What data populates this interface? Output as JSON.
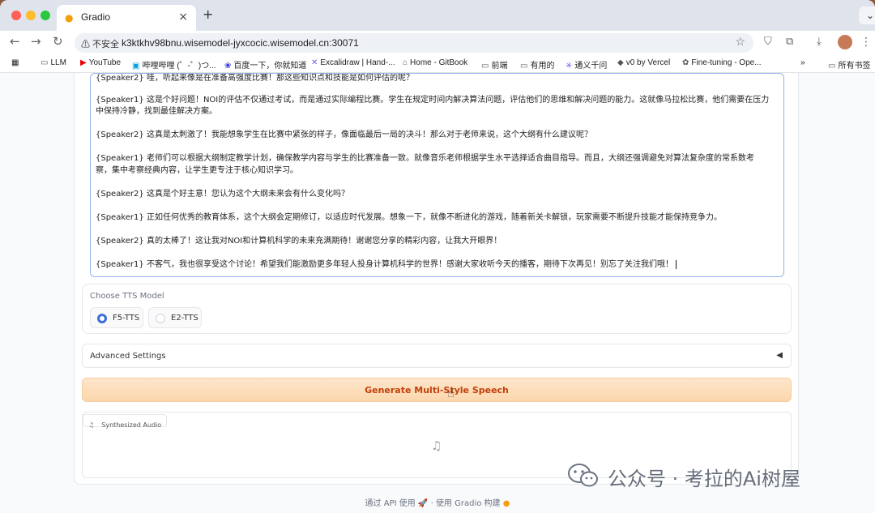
{
  "browser": {
    "tab_title": "Gradio",
    "tab_favicon": "gradio-favicon",
    "tab_close": "×",
    "new_tab": "+",
    "tab_menu": "⌄",
    "security": "⚠ 不安全",
    "url": "k3ktkhv98bnu.wisemodel-jyxcocic.wisemodel.cn:30071",
    "bookmarks": [
      {
        "label": "LLM",
        "icon": "folder-icon"
      },
      {
        "label": "YouTube",
        "icon": "youtube-icon"
      },
      {
        "label": "哔哩哔哩 (゜-゜)つ...",
        "icon": "bilibili-icon"
      },
      {
        "label": "百度一下，你就知道",
        "icon": "baidu-icon"
      },
      {
        "label": "Excalidraw | Hand-...",
        "icon": "excalidraw-icon"
      },
      {
        "label": "Home - GitBook",
        "icon": "gitbook-icon"
      },
      {
        "label": "前端",
        "icon": "folder-icon"
      },
      {
        "label": "有用的",
        "icon": "folder-icon"
      },
      {
        "label": "通义千问",
        "icon": "tongyi-icon"
      },
      {
        "label": "v0 by Vercel",
        "icon": "v0-icon"
      },
      {
        "label": "Fine-tuning - Ope...",
        "icon": "openai-icon"
      }
    ],
    "bookmarks_overflow": "»",
    "all_bookmarks": "所有书签"
  },
  "script": {
    "lines": [
      "{Speaker2} 哇，听起来像是在准备高强度比赛！那这些知识点和技能是如何评估的呢？",
      "",
      "{Speaker1} 这是个好问题！NOI的评估不仅通过考试，而是通过实际编程比赛。学生在规定时间内解决算法问题，评估他们的思维和解决问题的能力。这就像马拉松比赛，他们需要在压力",
      "中保持冷静，找到最佳解决方案。",
      "",
      "{Speaker2} 这真是太刺激了！我能想象学生在比赛中紧张的样子，像面临最后一局的决斗！那么对于老师来说，这个大纲有什么建议呢？",
      "",
      "{Speaker1} 老师们可以根据大纲制定教学计划，确保教学内容与学生的比赛准备一致。就像音乐老师根据学生水平选择适合曲目指导。而且，大纲还强调避免对算法复杂度的常系数考",
      "察，集中考察经典内容，让学生更专注于核心知识学习。",
      "",
      "{Speaker2} 这真是个好主意！您认为这个大纲未来会有什么变化吗？",
      "",
      "{Speaker1} 正如任何优秀的教育体系，这个大纲会定期修订，以适应时代发展。想象一下，就像不断进化的游戏，随着新关卡解锁，玩家需要不断提升技能才能保持竞争力。",
      "",
      "{Speaker2} 真的太棒了！这让我对NOI和计算机科学的未来充满期待！谢谢您分享的精彩内容，让我大开眼界！",
      "",
      "{Speaker1} 不客气，我也很享受这个讨论！希望我们能激励更多年轻人投身计算机科学的世界！感谢大家收听今天的播客，期待下次再见！别忘了关注我们哦！"
    ]
  },
  "tts": {
    "label": "Choose TTS Model",
    "options": [
      "F5-TTS",
      "E2-TTS"
    ],
    "selected": "F5-TTS"
  },
  "advanced": {
    "label": "Advanced Settings",
    "arrow": "◀"
  },
  "generate_button": "Generate Multi-Style Speech",
  "audio": {
    "label": "Synthesized Audio",
    "empty_icon": "music-note-icon"
  },
  "footer": {
    "api": "通过 API 使用",
    "sep": "·",
    "built": "使用 Gradio 构建"
  },
  "watermark": "公众号 · 考拉的Ai树屋"
}
